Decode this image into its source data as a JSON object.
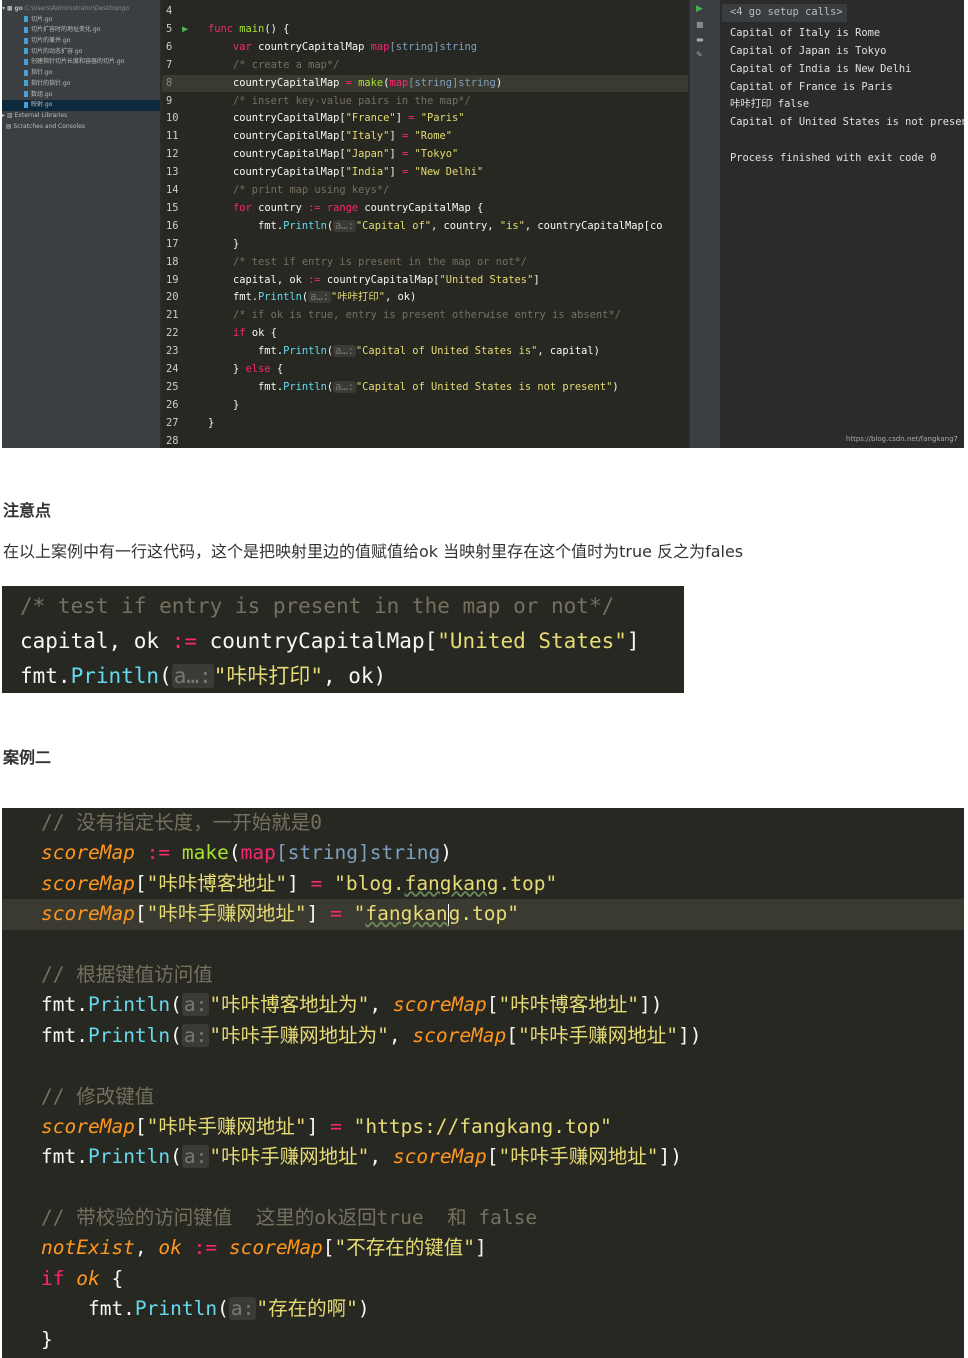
{
  "sidebar": {
    "root": "go",
    "root_path": "C:\\Users\\Administrator\\Desktop\\go",
    "files": [
      "切片.go",
      "切片扩容时的地址变化.go",
      "切片的兼并.go",
      "切片的动态扩容.go",
      "创建指针切片长度和容器的切片.go",
      "指针.go",
      "指针的指针.go",
      "数组.go",
      "映射.go"
    ],
    "selected": 8,
    "external": "External Libraries",
    "scratches": "Scratches and Consoles"
  },
  "editor": {
    "lines": [
      {
        "n": "4",
        "t": []
      },
      {
        "n": "5",
        "run": true,
        "t": [
          [
            "k",
            "func "
          ],
          [
            "f",
            "main"
          ],
          [
            "p",
            "() {"
          ]
        ]
      },
      {
        "n": "6",
        "t": [
          [
            "p",
            "    "
          ],
          [
            "k",
            "var "
          ],
          [
            "p",
            "countryCapitalMap "
          ],
          [
            "k",
            "map"
          ],
          [
            "t",
            "[string]string"
          ]
        ]
      },
      {
        "n": "7",
        "t": [
          [
            "p",
            "    "
          ],
          [
            "c",
            "/* create a map*/"
          ]
        ]
      },
      {
        "n": "8",
        "cur": true,
        "t": [
          [
            "p",
            "    countryCapitalMap "
          ],
          [
            "k",
            "= "
          ],
          [
            "f",
            "make"
          ],
          [
            "p",
            "("
          ],
          [
            "k",
            "map"
          ],
          [
            "t",
            "[string]string"
          ],
          [
            "p",
            ")"
          ]
        ]
      },
      {
        "n": "9",
        "t": [
          [
            "p",
            "    "
          ],
          [
            "c",
            "/* insert key-value pairs in the map*/"
          ]
        ]
      },
      {
        "n": "10",
        "t": [
          [
            "p",
            "    countryCapitalMap["
          ],
          [
            "s",
            "\"France\""
          ],
          [
            "p",
            "] "
          ],
          [
            "k",
            "= "
          ],
          [
            "s",
            "\"Paris\""
          ]
        ]
      },
      {
        "n": "11",
        "t": [
          [
            "p",
            "    countryCapitalMap["
          ],
          [
            "s",
            "\"Italy\""
          ],
          [
            "p",
            "] "
          ],
          [
            "k",
            "= "
          ],
          [
            "s",
            "\"Rome\""
          ]
        ]
      },
      {
        "n": "12",
        "t": [
          [
            "p",
            "    countryCapitalMap["
          ],
          [
            "s",
            "\"Japan\""
          ],
          [
            "p",
            "] "
          ],
          [
            "k",
            "= "
          ],
          [
            "s",
            "\"Tokyo\""
          ]
        ]
      },
      {
        "n": "13",
        "t": [
          [
            "p",
            "    countryCapitalMap["
          ],
          [
            "s",
            "\"India\""
          ],
          [
            "p",
            "] "
          ],
          [
            "k",
            "= "
          ],
          [
            "s",
            "\"New Delhi\""
          ]
        ]
      },
      {
        "n": "14",
        "t": [
          [
            "p",
            "    "
          ],
          [
            "c",
            "/* print map using keys*/"
          ]
        ]
      },
      {
        "n": "15",
        "t": [
          [
            "p",
            "    "
          ],
          [
            "k",
            "for "
          ],
          [
            "p",
            "country "
          ],
          [
            "k",
            ":= range "
          ],
          [
            "p",
            "countryCapitalMap {"
          ]
        ]
      },
      {
        "n": "16",
        "t": [
          [
            "p",
            "        fmt."
          ],
          [
            "b",
            "Println"
          ],
          [
            "p",
            "("
          ],
          [
            "h",
            "a…:"
          ],
          [
            "s",
            "\"Capital of\""
          ],
          [
            "p",
            ", country, "
          ],
          [
            "s",
            "\"is\""
          ],
          [
            "p",
            ", countryCapitalMap[co"
          ]
        ]
      },
      {
        "n": "17",
        "t": [
          [
            "p",
            "    }"
          ]
        ]
      },
      {
        "n": "18",
        "t": [
          [
            "p",
            "    "
          ],
          [
            "c",
            "/* test if entry is present in the map or not*/"
          ]
        ]
      },
      {
        "n": "19",
        "t": [
          [
            "p",
            "    capital, ok "
          ],
          [
            "k",
            ":= "
          ],
          [
            "p",
            "countryCapitalMap["
          ],
          [
            "s",
            "\"United States\""
          ],
          [
            "p",
            "]"
          ]
        ]
      },
      {
        "n": "20",
        "t": [
          [
            "p",
            "    fmt."
          ],
          [
            "b",
            "Println"
          ],
          [
            "p",
            "("
          ],
          [
            "h",
            "a…:"
          ],
          [
            "s",
            "\"咔咔打印\""
          ],
          [
            "p",
            ", ok)"
          ]
        ]
      },
      {
        "n": "21",
        "t": [
          [
            "p",
            "    "
          ],
          [
            "c",
            "/* if ok is true, entry is present otherwise entry is absent*/"
          ]
        ]
      },
      {
        "n": "22",
        "t": [
          [
            "p",
            "    "
          ],
          [
            "k",
            "if "
          ],
          [
            "p",
            "ok {"
          ]
        ]
      },
      {
        "n": "23",
        "t": [
          [
            "p",
            "        fmt."
          ],
          [
            "b",
            "Println"
          ],
          [
            "p",
            "("
          ],
          [
            "h",
            "a…:"
          ],
          [
            "s",
            "\"Capital of United States is\""
          ],
          [
            "p",
            ", capital)"
          ]
        ]
      },
      {
        "n": "24",
        "t": [
          [
            "p",
            "    } "
          ],
          [
            "k",
            "else "
          ],
          [
            "p",
            "{"
          ]
        ]
      },
      {
        "n": "25",
        "t": [
          [
            "p",
            "        fmt."
          ],
          [
            "b",
            "Println"
          ],
          [
            "p",
            "("
          ],
          [
            "h",
            "a…:"
          ],
          [
            "s",
            "\"Capital of United States is not present\""
          ],
          [
            "p",
            ")"
          ]
        ]
      },
      {
        "n": "26",
        "t": [
          [
            "p",
            "    }"
          ]
        ]
      },
      {
        "n": "27",
        "t": [
          [
            "p",
            "}"
          ]
        ]
      },
      {
        "n": "28",
        "t": []
      }
    ]
  },
  "output": {
    "fold": "<4 go setup calls>",
    "lines": [
      "Capital of Italy is Rome",
      "Capital of Japan is Tokyo",
      "Capital of India is New Delhi",
      "Capital of France is Paris",
      "咔咔打印 false",
      "Capital of United States is not present",
      "",
      "Process finished with exit code 0"
    ]
  },
  "watermark": "https://blog.csdn.net/fangkang7",
  "heading1": "注意点",
  "paragraph": "在以上案例中有一行这代码，这个是把映射里边的值赋值给ok 当映射里存在这个值时为true 反之为fales",
  "snippet": {
    "lines": [
      {
        "t": [
          [
            "c",
            "/* test if entry is present in the map or not*/"
          ]
        ]
      },
      {
        "t": [
          [
            "p",
            "capital, ok "
          ],
          [
            "k",
            ":= "
          ],
          [
            "p",
            "countryCapitalMap["
          ],
          [
            "s",
            "\"United States\""
          ],
          [
            "p",
            "]"
          ]
        ]
      },
      {
        "t": [
          [
            "p",
            "fmt."
          ],
          [
            "b",
            "Println"
          ],
          [
            "p",
            "("
          ],
          [
            "h",
            "a…:"
          ],
          [
            "s",
            "\"咔咔打印\""
          ],
          [
            "p",
            ", ok)"
          ]
        ]
      }
    ]
  },
  "heading2": "案例二",
  "example": {
    "lines": [
      {
        "t": [
          [
            "c",
            "// 没有指定长度，一开始就是0"
          ]
        ]
      },
      {
        "t": [
          [
            "v",
            "scoreMap "
          ],
          [
            "k",
            ":= "
          ],
          [
            "f",
            "make"
          ],
          [
            "p",
            "("
          ],
          [
            "k",
            "map"
          ],
          [
            "t",
            "[string]string"
          ],
          [
            "p",
            ")"
          ]
        ]
      },
      {
        "t": [
          [
            "v",
            "scoreMap"
          ],
          [
            "p",
            "["
          ],
          [
            "s",
            "\"咔咔博客地址\""
          ],
          [
            "p",
            "] "
          ],
          [
            "k",
            "= "
          ],
          [
            "s",
            "\"blog."
          ],
          [
            "s sq",
            "fangkang"
          ],
          [
            "s",
            ".top\""
          ]
        ]
      },
      {
        "cur": true,
        "t": [
          [
            "v",
            "scoreMap"
          ],
          [
            "p",
            "["
          ],
          [
            "s",
            "\"咔咔手赚网地址\""
          ],
          [
            "p",
            "] "
          ],
          [
            "k",
            "= "
          ],
          [
            "s",
            "\""
          ],
          [
            "s sq",
            "fangkan"
          ],
          [
            "caret",
            ""
          ],
          [
            "s sq",
            "g"
          ],
          [
            "s",
            ".top\""
          ]
        ]
      },
      {
        "t": []
      },
      {
        "t": [
          [
            "c",
            "// 根据键值访问值"
          ]
        ]
      },
      {
        "t": [
          [
            "p",
            "fmt."
          ],
          [
            "b",
            "Println"
          ],
          [
            "p",
            "("
          ],
          [
            "h",
            "a:"
          ],
          [
            "s",
            "\"咔咔博客地址为\""
          ],
          [
            "p",
            ", "
          ],
          [
            "v",
            "scoreMap"
          ],
          [
            "p",
            "["
          ],
          [
            "s",
            "\"咔咔博客地址\""
          ],
          [
            "p",
            "])"
          ]
        ]
      },
      {
        "t": [
          [
            "p",
            "fmt."
          ],
          [
            "b",
            "Println"
          ],
          [
            "p",
            "("
          ],
          [
            "h",
            "a:"
          ],
          [
            "s",
            "\"咔咔手赚网地址为\""
          ],
          [
            "p",
            ", "
          ],
          [
            "v",
            "scoreMap"
          ],
          [
            "p",
            "["
          ],
          [
            "s",
            "\"咔咔手赚网地址\""
          ],
          [
            "p",
            "])"
          ]
        ]
      },
      {
        "t": []
      },
      {
        "t": [
          [
            "c",
            "// 修改键值"
          ]
        ]
      },
      {
        "t": [
          [
            "v",
            "scoreMap"
          ],
          [
            "p",
            "["
          ],
          [
            "s",
            "\"咔咔手赚网地址\""
          ],
          [
            "p",
            "] "
          ],
          [
            "k",
            "= "
          ],
          [
            "s",
            "\"https://fangkang.top\""
          ]
        ]
      },
      {
        "t": [
          [
            "p",
            "fmt."
          ],
          [
            "b",
            "Println"
          ],
          [
            "p",
            "("
          ],
          [
            "h",
            "a:"
          ],
          [
            "s",
            "\"咔咔手赚网地址\""
          ],
          [
            "p",
            ", "
          ],
          [
            "v",
            "scoreMap"
          ],
          [
            "p",
            "["
          ],
          [
            "s",
            "\"咔咔手赚网地址\""
          ],
          [
            "p",
            "])"
          ]
        ]
      },
      {
        "t": []
      },
      {
        "t": [
          [
            "c",
            "// 带校验的访问键值  这里的ok返回true  和 false"
          ]
        ]
      },
      {
        "t": [
          [
            "v",
            "notExist"
          ],
          [
            "p",
            ", "
          ],
          [
            "v",
            "ok "
          ],
          [
            "k",
            ":= "
          ],
          [
            "v",
            "scoreMap"
          ],
          [
            "p",
            "["
          ],
          [
            "s",
            "\"不存在的键值\""
          ],
          [
            "p",
            "]"
          ]
        ]
      },
      {
        "t": [
          [
            "k",
            "if "
          ],
          [
            "v",
            "ok "
          ],
          [
            "p",
            "{"
          ]
        ]
      },
      {
        "t": [
          [
            "p",
            "    fmt."
          ],
          [
            "b",
            "Println"
          ],
          [
            "p",
            "("
          ],
          [
            "h",
            "a:"
          ],
          [
            "s",
            "\"存在的啊\""
          ],
          [
            "p",
            ")"
          ]
        ]
      },
      {
        "t": [
          [
            "p",
            "}"
          ]
        ]
      }
    ]
  },
  "colors": {
    "keyword": "#f92672",
    "string": "#e6db74",
    "comment": "#75715e",
    "variable": "#fd971f",
    "function": "#a6e22e",
    "builtin": "#66d9ef",
    "background": "#272822"
  }
}
